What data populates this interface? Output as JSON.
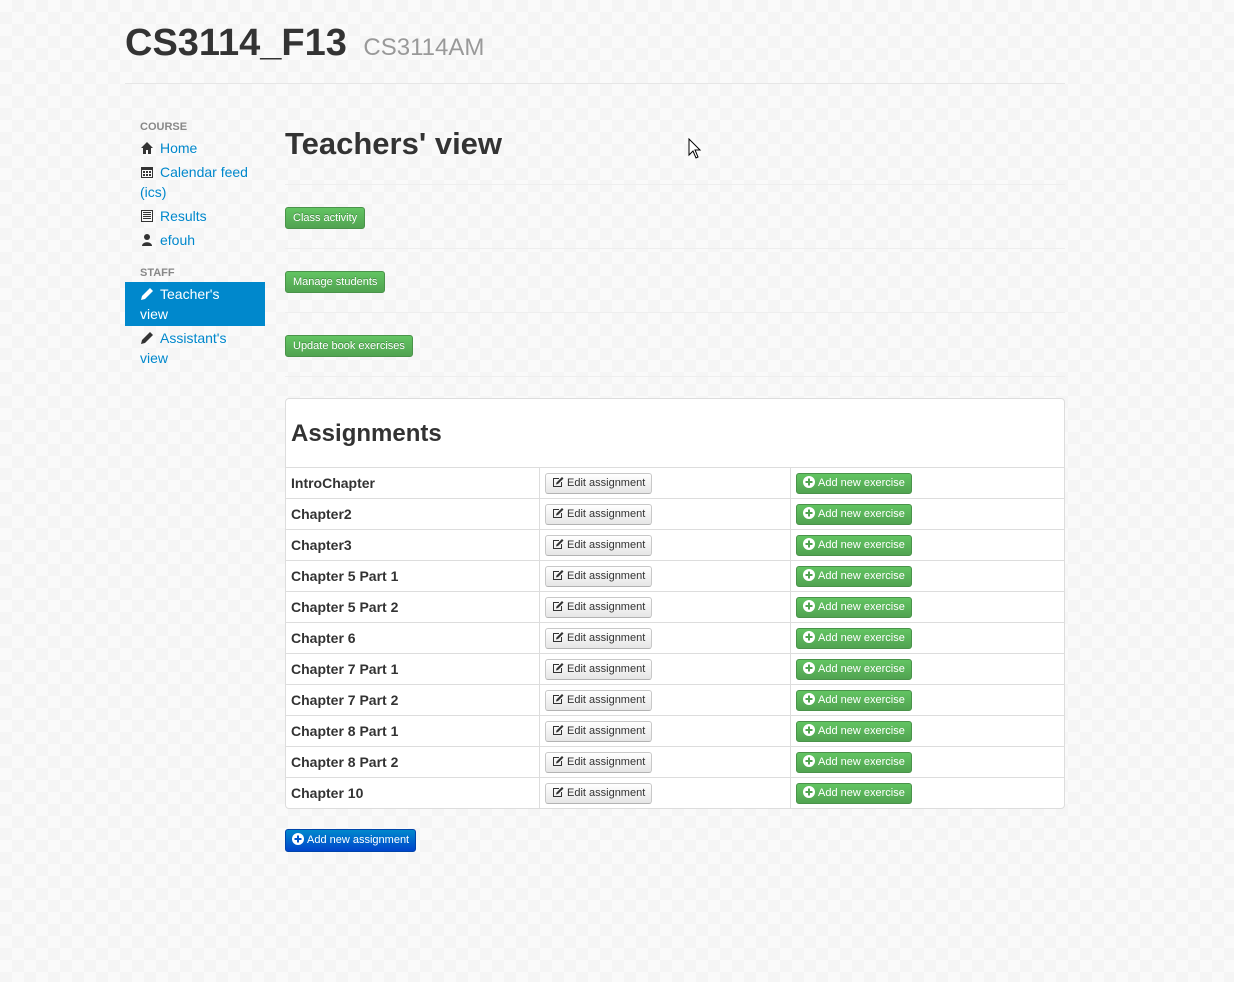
{
  "header": {
    "title": "CS3114_F13",
    "subtitle": "CS3114AM"
  },
  "sidebar": {
    "course_header": "COURSE",
    "course_items": [
      {
        "label": "Home",
        "icon": "home-icon"
      },
      {
        "label": "Calendar feed (ics)",
        "icon": "calendar-icon"
      },
      {
        "label": "Results",
        "icon": "list-icon"
      },
      {
        "label": "efouh",
        "icon": "user-icon"
      }
    ],
    "staff_header": "STAFF",
    "staff_items": [
      {
        "label": "Teacher's view",
        "icon": "pencil-icon",
        "active": true
      },
      {
        "label": "Assistant's view",
        "icon": "pencil-icon",
        "active": false
      }
    ]
  },
  "main": {
    "title": "Teachers' view",
    "actions": [
      "Class activity",
      "Manage students",
      "Update book exercises"
    ],
    "assignments_title": "Assignments",
    "edit_label": "Edit assignment",
    "add_exercise_label": "Add new exercise",
    "assignments": [
      "IntroChapter",
      "Chapter2",
      "Chapter3",
      "Chapter 5 Part 1",
      "Chapter 5 Part 2",
      "Chapter 6",
      "Chapter 7 Part 1",
      "Chapter 7 Part 2",
      "Chapter 8 Part 1",
      "Chapter 8 Part 2",
      "Chapter 10"
    ],
    "add_assignment_label": "Add new assignment"
  },
  "colors": {
    "link": "#0088cc",
    "success": "#51a351",
    "primary": "#0044cc"
  }
}
